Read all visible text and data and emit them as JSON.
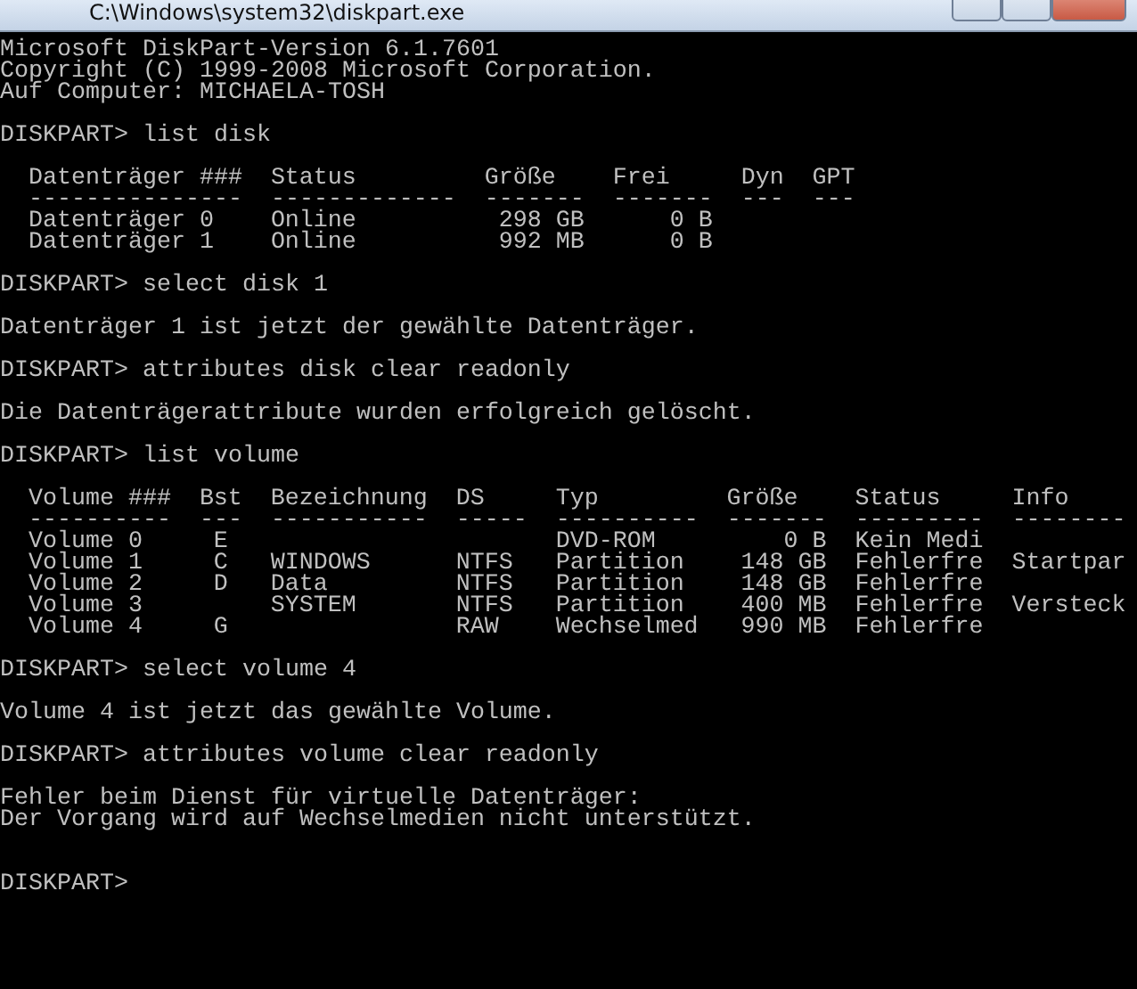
{
  "window": {
    "title": "C:\\Windows\\system32\\diskpart.exe"
  },
  "console": [
    {
      "kind": "line",
      "text": "Microsoft DiskPart-Version 6.1.7601"
    },
    {
      "kind": "line",
      "text": "Copyright (C) 1999-2008 Microsoft Corporation."
    },
    {
      "kind": "line",
      "text": "Auf Computer: MICHAELA-TOSH"
    },
    {
      "kind": "blank"
    },
    {
      "kind": "line",
      "text": "DISKPART> list disk"
    },
    {
      "kind": "blank"
    },
    {
      "kind": "table",
      "columns": [
        {
          "header": "Datenträger ###",
          "rule": "---------------",
          "kind": "text"
        },
        {
          "header": "Status",
          "rule": "-------------",
          "kind": "text"
        },
        {
          "header": "Größe",
          "rule": "-------",
          "kind": "number"
        },
        {
          "header": "Frei",
          "rule": "-------",
          "kind": "number"
        },
        {
          "header": "Dyn",
          "rule": "---",
          "kind": "text"
        },
        {
          "header": "GPT",
          "rule": "---",
          "kind": "text"
        }
      ],
      "rows": [
        [
          "Datenträger 0",
          "Online",
          "298 GB",
          "0 B"
        ],
        [
          "Datenträger 1",
          "Online",
          "992 MB",
          "0 B"
        ]
      ]
    },
    {
      "kind": "blank"
    },
    {
      "kind": "line",
      "text": "DISKPART> select disk 1"
    },
    {
      "kind": "blank"
    },
    {
      "kind": "line",
      "text": "Datenträger 1 ist jetzt der gewählte Datenträger."
    },
    {
      "kind": "blank"
    },
    {
      "kind": "line",
      "text": "DISKPART> attributes disk clear readonly"
    },
    {
      "kind": "blank"
    },
    {
      "kind": "line",
      "text": "Die Datenträgerattribute wurden erfolgreich gelöscht."
    },
    {
      "kind": "blank"
    },
    {
      "kind": "line",
      "text": "DISKPART> list volume"
    },
    {
      "kind": "blank"
    },
    {
      "kind": "table",
      "columns": [
        {
          "header": "Volume ###",
          "rule": "----------",
          "kind": "text"
        },
        {
          "header": "Bst",
          "rule": "---",
          "kind": "letter"
        },
        {
          "header": "Bezeichnung",
          "rule": "-----------",
          "kind": "text"
        },
        {
          "header": "DS",
          "rule": "-----",
          "kind": "text"
        },
        {
          "header": "Typ",
          "rule": "----------",
          "kind": "text"
        },
        {
          "header": "Größe",
          "rule": "-------",
          "kind": "number"
        },
        {
          "header": "Status",
          "rule": "---------",
          "kind": "text"
        },
        {
          "header": "Info",
          "rule": "--------",
          "kind": "text"
        }
      ],
      "rows": [
        [
          "Volume 0",
          "E",
          null,
          null,
          "DVD-ROM",
          "0 B",
          "Kein Medi"
        ],
        [
          "Volume 1",
          "C",
          "WINDOWS",
          "NTFS",
          "Partition",
          "148 GB",
          "Fehlerfre",
          "Startpar"
        ],
        [
          "Volume 2",
          "D",
          "Data",
          "NTFS",
          "Partition",
          "148 GB",
          "Fehlerfre"
        ],
        [
          "Volume 3",
          null,
          "SYSTEM",
          "NTFS",
          "Partition",
          "400 MB",
          "Fehlerfre",
          "Versteck"
        ],
        [
          "Volume 4",
          "G",
          null,
          "RAW",
          "Wechselmed",
          "990 MB",
          "Fehlerfre"
        ]
      ]
    },
    {
      "kind": "blank"
    },
    {
      "kind": "line",
      "text": "DISKPART> select volume 4"
    },
    {
      "kind": "blank"
    },
    {
      "kind": "line",
      "text": "Volume 4 ist jetzt das gewählte Volume."
    },
    {
      "kind": "blank"
    },
    {
      "kind": "line",
      "text": "DISKPART> attributes volume clear readonly"
    },
    {
      "kind": "blank"
    },
    {
      "kind": "line",
      "text": "Fehler beim Dienst für virtuelle Datenträger:"
    },
    {
      "kind": "line",
      "text": "Der Vorgang wird auf Wechselmedien nicht unterstützt."
    },
    {
      "kind": "blank"
    },
    {
      "kind": "blank"
    },
    {
      "kind": "line",
      "text": "DISKPART>"
    }
  ]
}
